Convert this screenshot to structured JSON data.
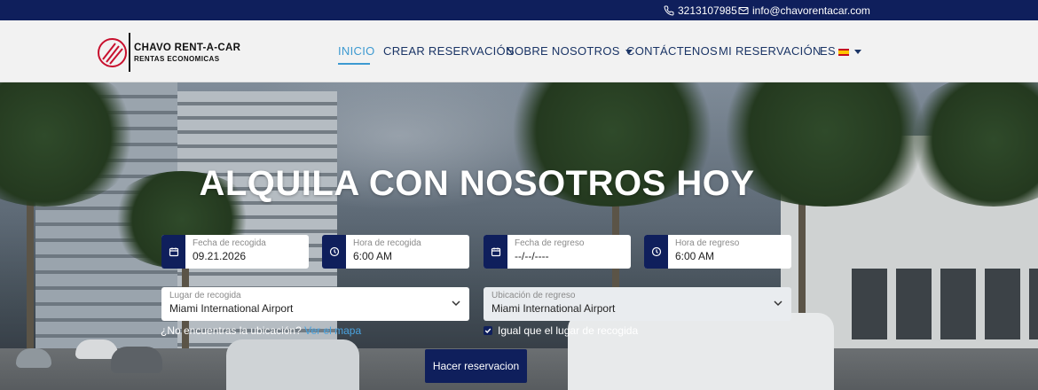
{
  "topbar": {
    "phone": "3213107985",
    "email": "info@chavorentacar.com"
  },
  "brand": {
    "name": "CHAVO RENT-A-CAR",
    "tagline": "RENTAS ECONOMICAS"
  },
  "nav": {
    "items": [
      {
        "label": "INICIO"
      },
      {
        "label": "CREAR RESERVACIÓN"
      },
      {
        "label": "SOBRE NOSOTROS"
      },
      {
        "label": "CONTÁCTENOS"
      },
      {
        "label": "MI RESERVACIÓN"
      },
      {
        "label": "ES"
      }
    ]
  },
  "hero": {
    "title": "ALQUILA CON NOSOTROS HOY"
  },
  "form": {
    "pickup_date": {
      "label": "Fecha de recogida",
      "value": "09.21.2026"
    },
    "pickup_time": {
      "label": "Hora de recogida",
      "value": "6:00 AM"
    },
    "return_date": {
      "label": "Fecha de regreso",
      "value": "--/--/----"
    },
    "return_time": {
      "label": "Hora de regreso",
      "value": "6:00 AM"
    },
    "pickup_location": {
      "label": "Lugar de recogida",
      "value": "Miami International Airport"
    },
    "return_location": {
      "label": "Ubicación de regreso",
      "value": "Miami International Airport"
    },
    "hint_text": "¿No encuentras la ubicación?",
    "hint_link": "Ver el mapa",
    "same_location_label": "Igual que el lugar de recogida",
    "same_location_checked": true,
    "submit_label": "Hacer reservacion"
  },
  "colors": {
    "navy": "#0f1f5c",
    "accent": "#3d9ad1",
    "brand_red": "#c8102e"
  }
}
